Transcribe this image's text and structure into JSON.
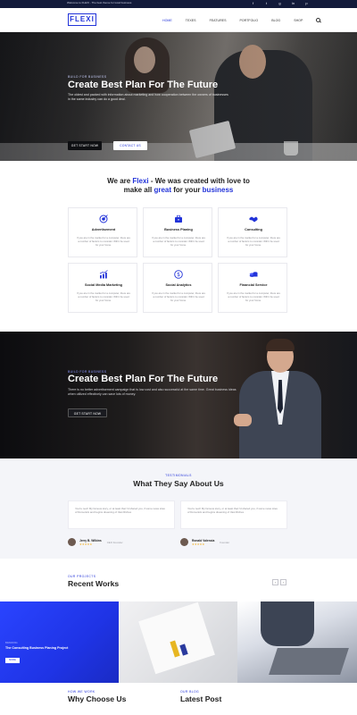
{
  "topbar": {
    "text": "Welcome to FLEXI - The best theme for local business",
    "socials": [
      "f",
      "t",
      "g",
      "in",
      "p"
    ]
  },
  "header": {
    "logo": "FLEXI",
    "nav": [
      "HOME",
      "TEXES",
      "FEATURES",
      "PORTFOLIO",
      "BLOG",
      "SHOP"
    ]
  },
  "hero": {
    "eyebrow": "BUILD FOR BUSINESS",
    "title": "Create Best Plan For The Future",
    "description": "The oldest and packed with information about marketing and how cooperation between the owners of businesses in the same industry can do a good deal.",
    "primary_button": "GET START NOW",
    "secondary_button": "CONTACT US"
  },
  "services": {
    "heading_1": "We are ",
    "heading_brand": "Flexi",
    "heading_2": " - We was created with love to",
    "heading_3": "make all ",
    "heading_great": "great",
    "heading_4": " for your ",
    "heading_business": "business",
    "cards": [
      {
        "title": "Advertisement",
        "text": "If you are in the market for a computer, there are a number of factors to consider. Will it be used for your home.",
        "icon": "target-icon"
      },
      {
        "title": "Business Planing",
        "text": "If you are in the market for a computer, there are a number of factors to consider. Will it be used for your home.",
        "icon": "briefcase-icon"
      },
      {
        "title": "Consulting",
        "text": "If you are in the market for a computer, there are a number of factors to consider. Will it be used for your home.",
        "icon": "handshake-icon"
      },
      {
        "title": "Social Media Marketing",
        "text": "If you are in the market for a computer, there are a number of factors to consider. Will it be used for your home.",
        "icon": "growth-chart-icon"
      },
      {
        "title": "Social Analytics",
        "text": "If you are in the market for a computer, there are a number of factors to consider. Will it be used for your home.",
        "icon": "dollar-coin-icon"
      },
      {
        "title": "Financial Service",
        "text": "If you are in the market for a computer, there are a number of factors to consider. Will it be used for your home.",
        "icon": "coins-icon"
      }
    ]
  },
  "banner2": {
    "eyebrow": "BUILD FOR BUSINESS",
    "title": "Create Best Plan For The Future",
    "description": "There is no better advertisement campaign that is low cost and also successful at the same time. Great business ideas when utilized effectively can save lots of money.",
    "button": "GET START NOW"
  },
  "testimonials": {
    "eyebrow": "TESTIMONIALS",
    "title": "What They Say About Us",
    "items": [
      {
        "quote": "You're next! My famous story, or at least that I'd shared you, if some news sites of Domenick and begins dreaming of Vast Riches",
        "name": "Jerry B. Wilkins",
        "role": "CEO Founder",
        "stars": "★★★★★"
      },
      {
        "quote": "You're next! My famous story, or at least that I'd shared you, if some news sites of Domenick and begins dreaming of Vast Riches",
        "name": "Ronald Valencia",
        "role": "Founder",
        "stars": "★★★★★"
      }
    ]
  },
  "works": {
    "eyebrow": "OUR PROJECTS",
    "title": "Recent Works",
    "prev": "‹",
    "next": "›",
    "featured": {
      "meta": "BRANDING",
      "title": "The Consulting Business Planing Project",
      "button": "MORE"
    }
  },
  "why": {
    "eyebrow": "HOW WE WORK",
    "title": "Why Choose Us"
  },
  "blog": {
    "eyebrow": "OUR BLOG",
    "title": "Latest Post"
  },
  "colors": {
    "accent": "#2233d9",
    "dark": "#121a3a",
    "star": "#f3b022"
  }
}
